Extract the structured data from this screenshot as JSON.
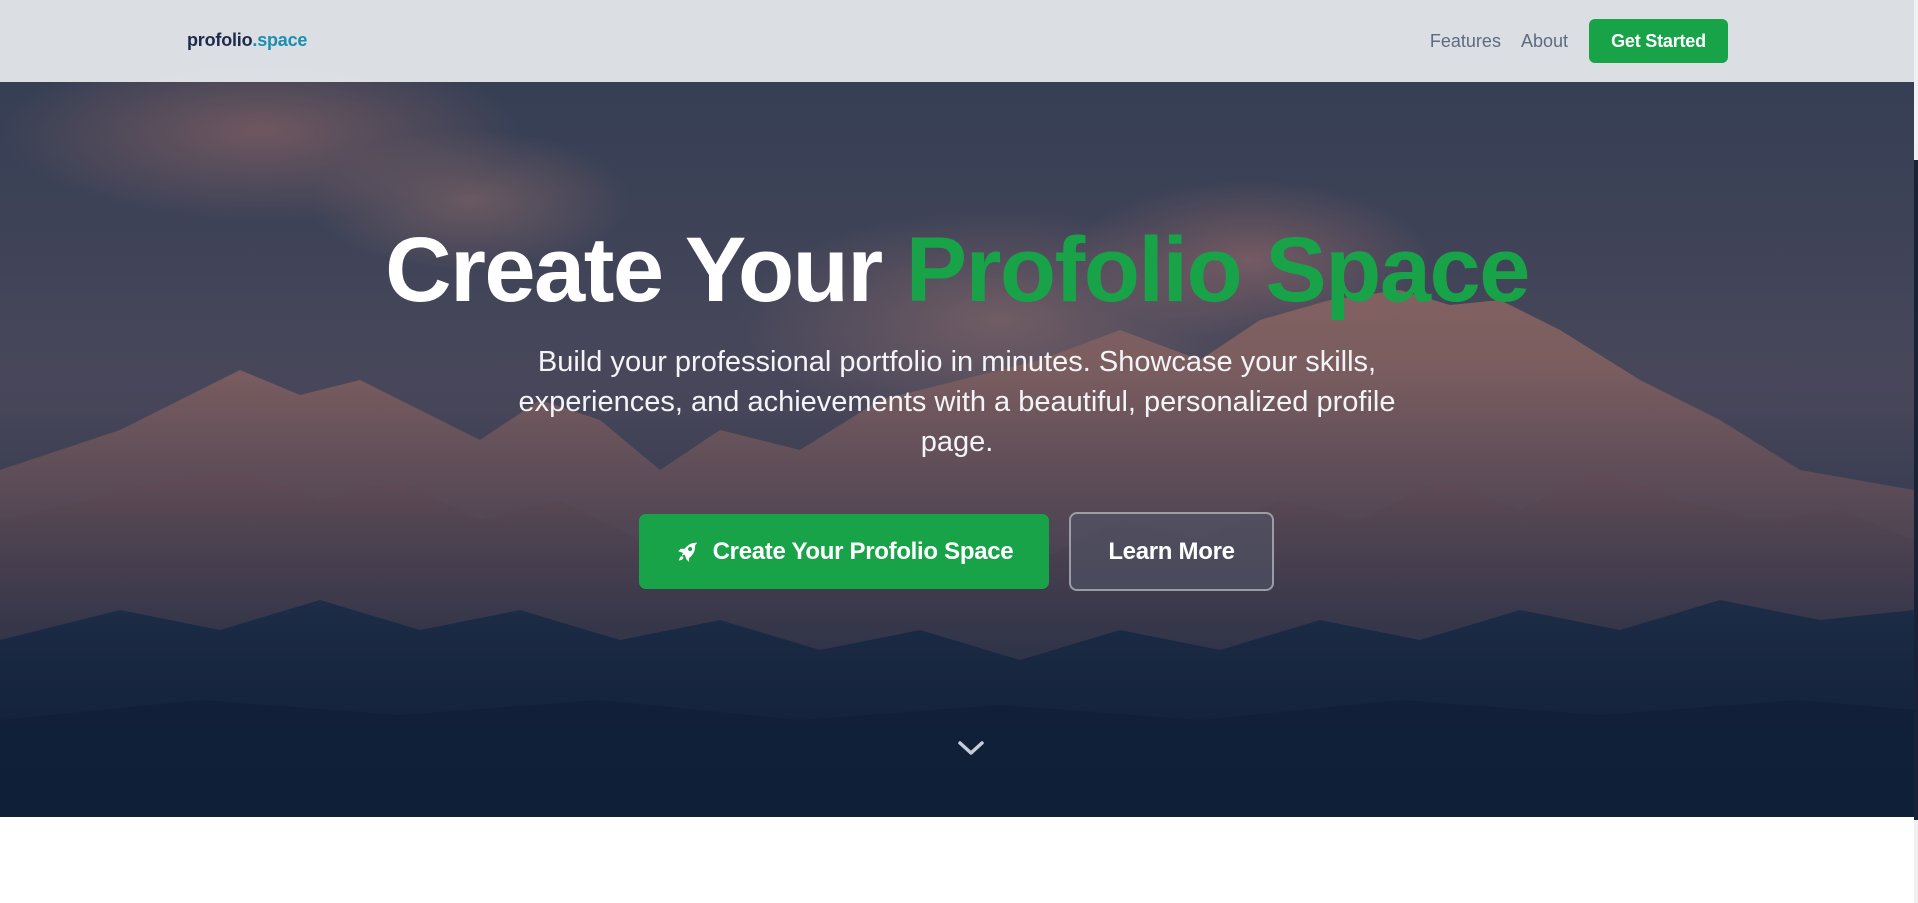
{
  "nav": {
    "logo_main": "profolio",
    "logo_accent": ".space",
    "links": [
      "Features",
      "About"
    ],
    "cta_label": "Get Started"
  },
  "hero": {
    "title_white": "Create Your",
    "title_green": "Profolio Space",
    "subtitle": "Build your professional portfolio in minutes. Showcase your skills, experiences, and achievements with a beautiful, personalized profile page.",
    "primary_label": "Create Your Profolio Space",
    "primary_icon": "rocket-icon",
    "secondary_label": "Learn More",
    "scroll_icon": "chevron-down-icon"
  },
  "colors": {
    "brand_green": "#18a349",
    "logo_dark": "#1e2a4a",
    "logo_accent": "#1b8fb0",
    "nav_link": "#5d6b80",
    "navbar_bg": "#e2e5e9"
  }
}
